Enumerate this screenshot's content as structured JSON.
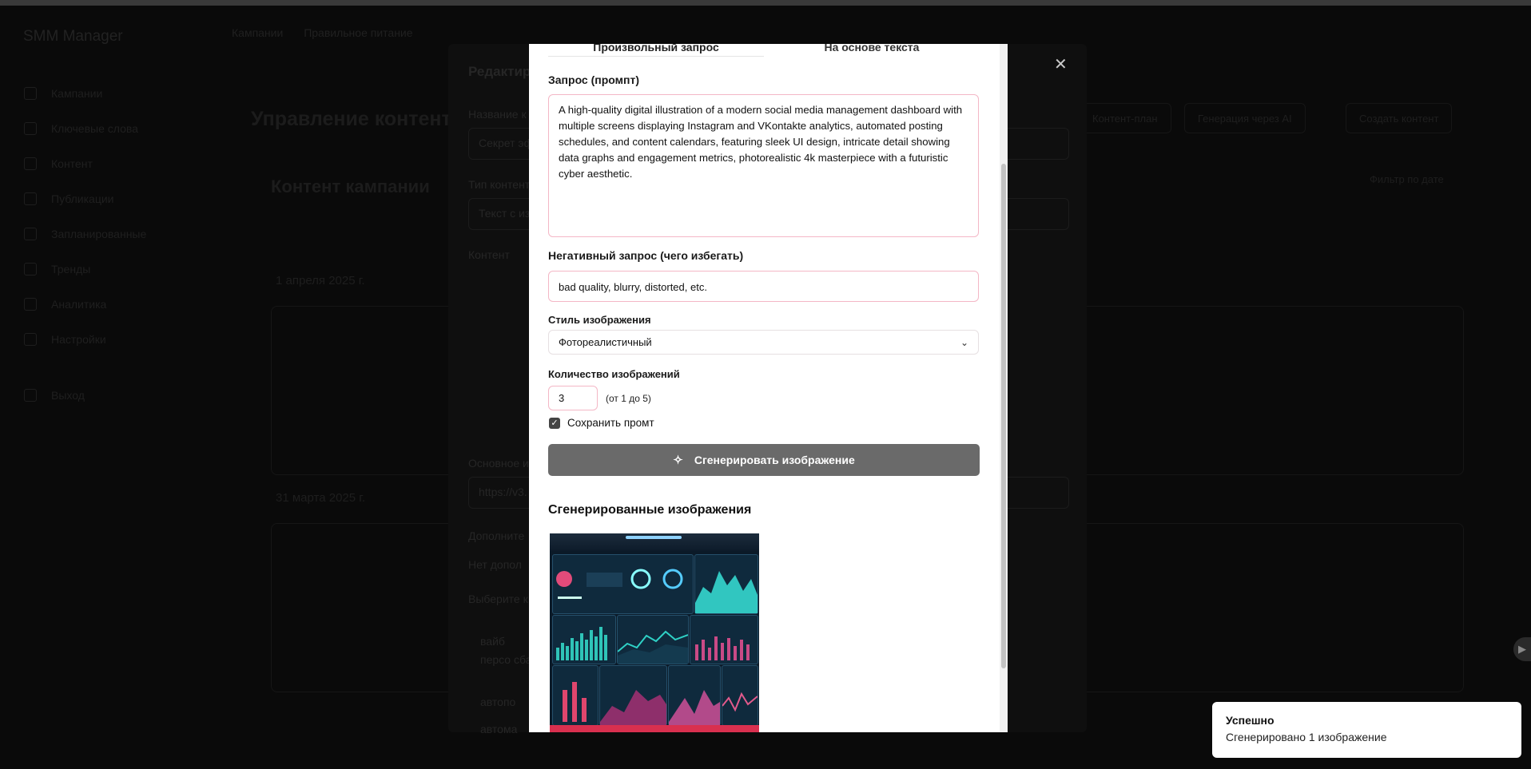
{
  "background": {
    "brand": "SMM Manager",
    "tabs": [
      "Кампании",
      "Правильное питание"
    ],
    "nav": [
      "Кампании",
      "Ключевые слова",
      "Контент",
      "Публикации",
      "Запланированные",
      "Тренды",
      "Аналитика",
      "Настройки",
      "Выход"
    ],
    "page_title": "Управление контентом",
    "section_title": "Контент кампании",
    "dates": [
      "1 апреля 2025 г.",
      "31 марта 2025 г."
    ],
    "buttons": [
      "Контент-план",
      "Генерация через AI",
      "Создать контент"
    ],
    "filter": "Фильтр по дате"
  },
  "mid_dialog": {
    "title": "Редактир",
    "fields": [
      "Название к",
      "Тип контент",
      "Контент",
      "Основное и",
      "Дополните",
      "Выберите к"
    ],
    "values": [
      "Секрет эф",
      "Текст с из",
      "https://v3.",
      "Нет допол"
    ],
    "keywords": [
      "вайб",
      "персо сбалан",
      "автопо",
      "автома"
    ]
  },
  "modal": {
    "tabs": [
      "Произвольный запрос",
      "На основе текста"
    ],
    "prompt_label": "Запрос (промпт)",
    "prompt_value": "A high-quality digital illustration of a modern social media management dashboard with multiple screens displaying Instagram and VKontakte analytics, automated posting schedules, and content calendars, featuring sleek UI design, intricate detail showing data graphs and engagement metrics, photorealistic 4k masterpiece with a futuristic cyber aesthetic.",
    "negative_label": "Негативный запрос (чего избегать)",
    "negative_value": "bad quality, blurry, distorted, etc.",
    "style_label": "Стиль изображения",
    "style_value": "Фотореалистичный",
    "count_label": "Количество изображений",
    "count_value": "3",
    "count_hint": "(от 1 до 5)",
    "save_prompt_label": "Сохранить промт",
    "save_prompt_checked": true,
    "generate_button": "Сгенерировать изображение",
    "generated_title": "Сгенерированные изображения"
  },
  "toast": {
    "title": "Успешно",
    "message": "Сгенерировано 1 изображение"
  },
  "colors": {
    "accent_border": "#f4b7c6",
    "generate_button": "#6a6a6a",
    "overlay": "#0a0a0a"
  }
}
